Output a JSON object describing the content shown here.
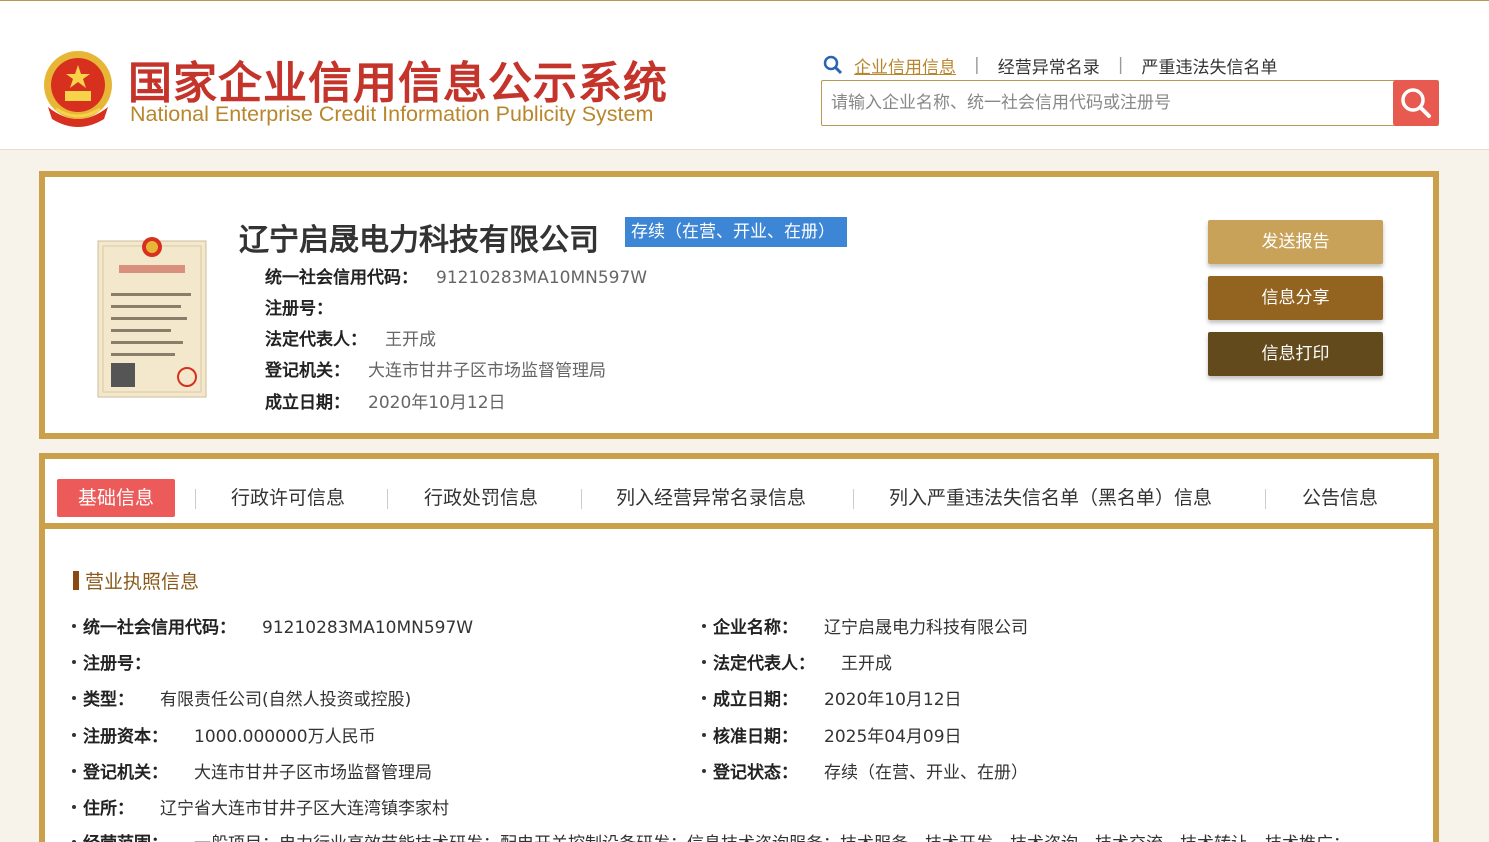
{
  "header": {
    "title_cn": "国家企业信用信息公示系统",
    "title_en": "National Enterprise Credit Information Publicity System",
    "nav": [
      "企业信用信息",
      "经营异常名录",
      "严重违法失信名单"
    ],
    "nav_sep": "|",
    "search_placeholder": "请输入企业名称、统一社会信用代码或注册号",
    "icons": {
      "search": "search-icon",
      "magnifier": "magnifier-icon",
      "emblem": "national-emblem-icon"
    }
  },
  "company": {
    "name": "辽宁启晟电力科技有限公司",
    "status": "存续（在营、开业、在册）",
    "fields": [
      {
        "label": "统一社会信用代码：",
        "value": "91210283MA10MN597W"
      },
      {
        "label": "注册号：",
        "value": ""
      },
      {
        "label": "法定代表人：",
        "value": "王开成"
      },
      {
        "label": "登记机关：",
        "value": "大连市甘井子区市场监督管理局"
      },
      {
        "label": "成立日期：",
        "value": "2020年10月12日"
      }
    ],
    "actions": [
      "发送报告",
      "信息分享",
      "信息打印"
    ]
  },
  "tabs": [
    "基础信息",
    "行政许可信息",
    "行政处罚信息",
    "列入经营异常名录信息",
    "列入严重违法失信名单（黑名单）信息",
    "公告信息"
  ],
  "license_section": {
    "title": "营业执照信息",
    "left": [
      {
        "label": "统一社会信用代码：",
        "value": "91210283MA10MN597W"
      },
      {
        "label": "注册号：",
        "value": ""
      },
      {
        "label": "类型：",
        "value": "有限责任公司(自然人投资或控股)"
      },
      {
        "label": "注册资本：",
        "value": "1000.000000万人民币"
      },
      {
        "label": "登记机关：",
        "value": "大连市甘井子区市场监督管理局"
      },
      {
        "label": "住所：",
        "value": "辽宁省大连市甘井子区大连湾镇李家村"
      },
      {
        "label": "经营范围：",
        "value": "一般项目：电力行业高效节能技术研发；配电开关控制设备研发；信息技术咨询服务；技术服务、技术开发、技术咨询、技术交流、技术转让、技术推广；"
      }
    ],
    "right": [
      {
        "label": "企业名称：",
        "value": "辽宁启晟电力科技有限公司"
      },
      {
        "label": "法定代表人：",
        "value": "王开成"
      },
      {
        "label": "成立日期：",
        "value": "2020年10月12日"
      },
      {
        "label": "核准日期：",
        "value": "2025年04月09日"
      },
      {
        "label": "登记状态：",
        "value": "存续（在营、开业、在册）"
      }
    ]
  },
  "colors": {
    "brand_red": "#c4342b",
    "gold": "#caa04a",
    "active_tab": "#ec5a5a",
    "status_blue": "#3d86d6"
  }
}
